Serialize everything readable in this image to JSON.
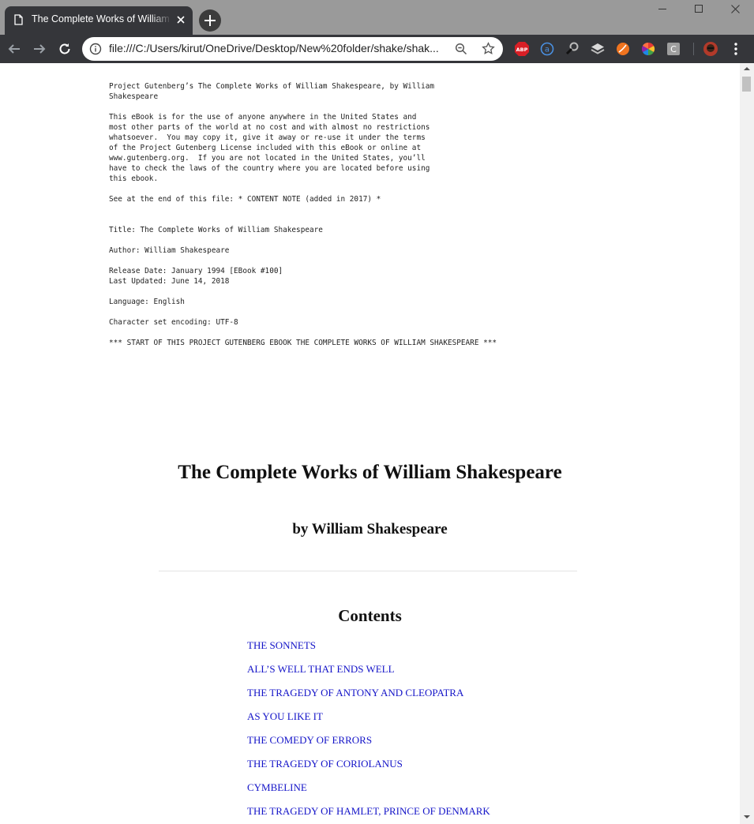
{
  "window": {
    "tab": {
      "title": "The Complete Works of William Shakespeare",
      "favicon": "document-icon"
    },
    "controls": [
      "minimize-icon",
      "maximize-icon",
      "close-icon"
    ]
  },
  "toolbar": {
    "url": "file:///C:/Users/kirut/OneDrive/Desktop/New%20folder/shake/shak...",
    "extensions": [
      {
        "name": "adblock-plus-icon",
        "text": "ABP",
        "color": "#d81f26"
      },
      {
        "name": "a-circle-icon",
        "text": "a",
        "color": "#1a73e8"
      },
      {
        "name": "magnifier-extension-icon",
        "text": "",
        "color": "#000000"
      },
      {
        "name": "layers-extension-icon",
        "text": "",
        "color": "#cfcfcf"
      },
      {
        "name": "orange-circle-extension-icon",
        "text": "",
        "color": "#f0741f"
      },
      {
        "name": "color-wheel-extension-icon",
        "text": "",
        "color": "#4caf50"
      },
      {
        "name": "c-square-extension-icon",
        "text": "C",
        "color": "#9e9e9e"
      }
    ]
  },
  "header_text": [
    "Project Gutenberg’s The Complete Works of William Shakespeare, by William",
    "Shakespeare",
    "",
    "This eBook is for the use of anyone anywhere in the United States and",
    "most other parts of the world at no cost and with almost no restrictions",
    "whatsoever.  You may copy it, give it away or re-use it under the terms",
    "of the Project Gutenberg License included with this eBook or online at",
    "www.gutenberg.org.  If you are not located in the United States, you’ll",
    "have to check the laws of the country where you are located before using",
    "this ebook.",
    "",
    "See at the end of this file: * CONTENT NOTE (added in 2017) *",
    "",
    "",
    "Title: The Complete Works of William Shakespeare",
    "",
    "Author: William Shakespeare",
    "",
    "Release Date: January 1994 [EBook #100]",
    "Last Updated: June 14, 2018",
    "",
    "Language: English",
    "",
    "Character set encoding: UTF-8",
    "",
    "*** START OF THIS PROJECT GUTENBERG EBOOK THE COMPLETE WORKS OF WILLIAM SHAKESPEARE ***"
  ],
  "book": {
    "title": "The Complete Works of William Shakespeare",
    "byline": "by William Shakespeare",
    "contents_heading": "Contents",
    "contents": [
      "THE SONNETS",
      "ALL’S WELL THAT ENDS WELL",
      "THE TRAGEDY OF ANTONY AND CLEOPATRA",
      "AS YOU LIKE IT",
      "THE COMEDY OF ERRORS",
      "THE TRAGEDY OF CORIOLANUS",
      "CYMBELINE",
      "THE TRAGEDY OF HAMLET, PRINCE OF DENMARK"
    ]
  },
  "colors": {
    "link": "#1414c8",
    "chrome_dark": "#35363a",
    "titlebar": "#9a9a9a"
  }
}
